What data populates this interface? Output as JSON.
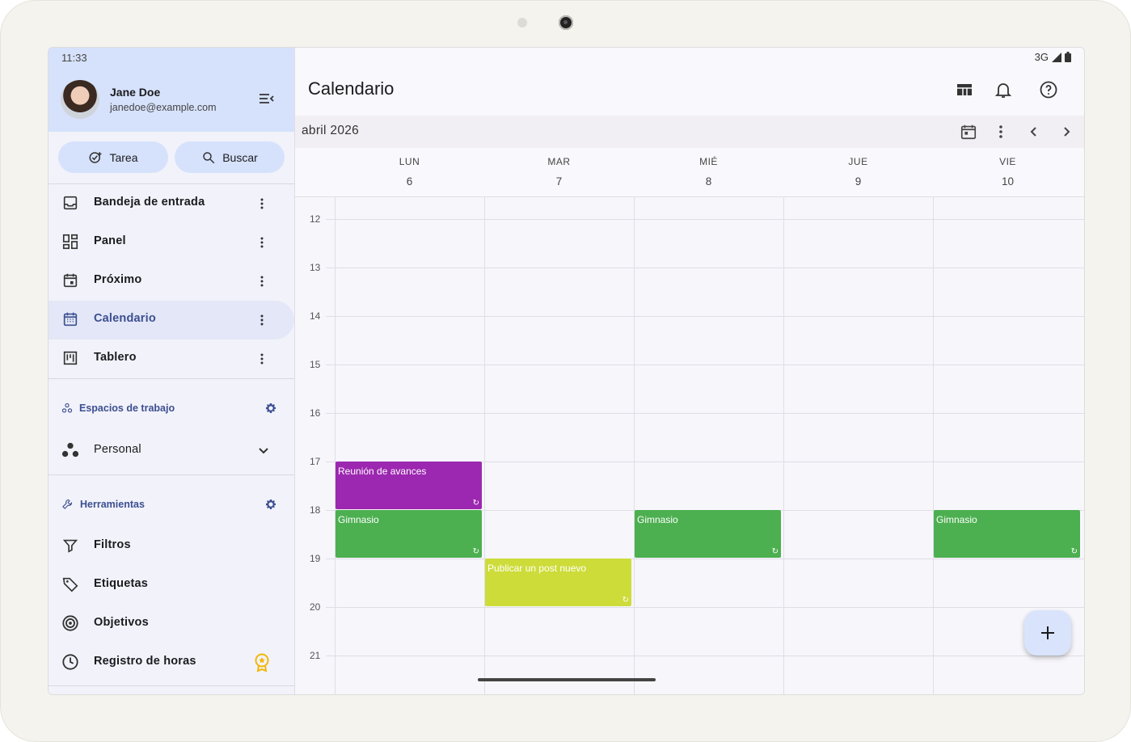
{
  "status": {
    "time": "11:33",
    "network": "3G"
  },
  "user": {
    "name": "Jane Doe",
    "email": "janedoe@example.com"
  },
  "actions": {
    "task": "Tarea",
    "search": "Buscar"
  },
  "nav": [
    {
      "label": "Bandeja de entrada",
      "icon": "inbox-icon"
    },
    {
      "label": "Panel",
      "icon": "dashboard-icon"
    },
    {
      "label": "Próximo",
      "icon": "calendar-upcoming-icon"
    },
    {
      "label": "Calendario",
      "icon": "calendar-icon",
      "active": true
    },
    {
      "label": "Tablero",
      "icon": "board-icon"
    }
  ],
  "workspaces": {
    "title": "Espacios de trabajo",
    "current": "Personal"
  },
  "tools": {
    "title": "Herramientas",
    "items": [
      {
        "label": "Filtros",
        "icon": "filter-icon"
      },
      {
        "label": "Etiquetas",
        "icon": "label-icon"
      },
      {
        "label": "Objetivos",
        "icon": "target-icon"
      },
      {
        "label": "Registro de horas",
        "icon": "clock-icon"
      }
    ]
  },
  "main": {
    "title": "Calendario",
    "month": "abril 2026"
  },
  "days": [
    {
      "name": "LUN",
      "date": "6"
    },
    {
      "name": "MAR",
      "date": "7"
    },
    {
      "name": "MIÉ",
      "date": "8"
    },
    {
      "name": "JUE",
      "date": "9"
    },
    {
      "name": "VIE",
      "date": "10"
    }
  ],
  "hours": [
    "12",
    "13",
    "14",
    "15",
    "16",
    "17",
    "18",
    "19",
    "20",
    "21"
  ],
  "events": [
    {
      "title": "Reunión de avances",
      "day": 0,
      "start": 17,
      "end": 18,
      "color": "#9c27b0"
    },
    {
      "title": "Gimnasio",
      "day": 0,
      "start": 18,
      "end": 19,
      "color": "#4caf50"
    },
    {
      "title": "Gimnasio",
      "day": 2,
      "start": 18,
      "end": 19,
      "color": "#4caf50"
    },
    {
      "title": "Gimnasio",
      "day": 4,
      "start": 18,
      "end": 19,
      "color": "#4caf50"
    },
    {
      "title": "Publicar un post nuevo",
      "day": 1,
      "start": 19,
      "end": 20,
      "color": "#cddc39"
    }
  ],
  "colors": {
    "accent": "#3c4f91",
    "header": "#d6e2fb"
  }
}
